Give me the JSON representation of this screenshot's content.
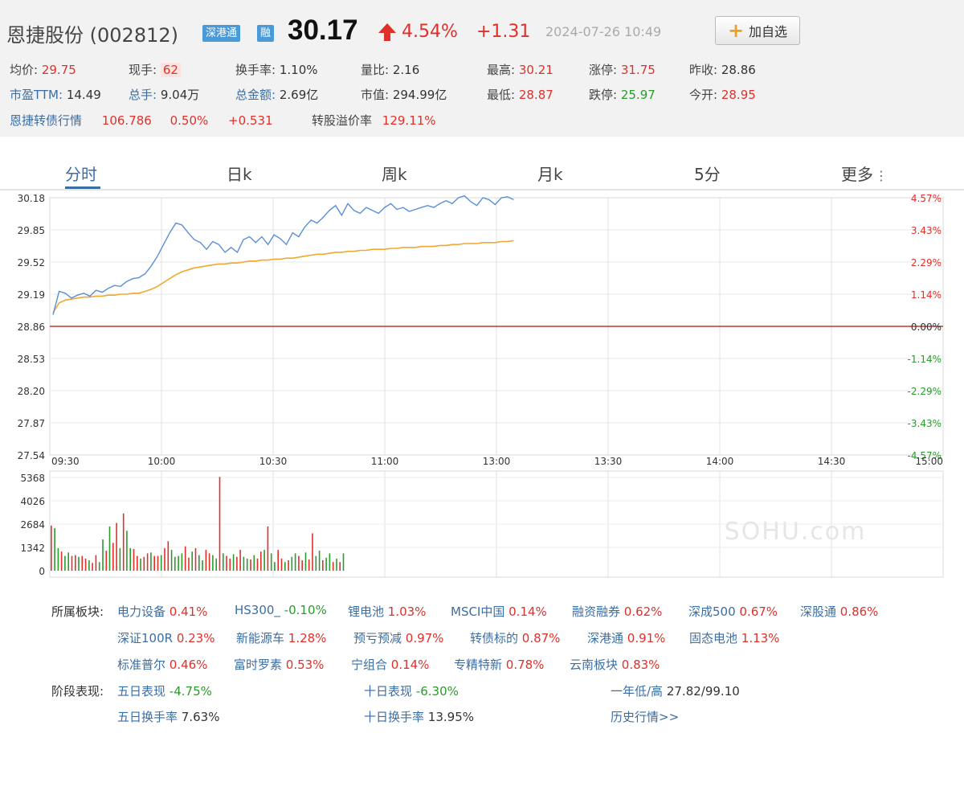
{
  "header": {
    "stock_name": "恩捷股份",
    "stock_code": "(002812)",
    "badges": [
      "深港通",
      "融"
    ],
    "price": "30.17",
    "change_pct": "4.54%",
    "change_amt": "+1.31",
    "datetime": "2024-07-26 10:49",
    "add_button": "加自选",
    "colors": {
      "up": "#e0302a",
      "down": "#2c9a2c",
      "link": "#3a6ea5",
      "badge": "#4b9ad8"
    }
  },
  "quote": {
    "avg_label": "均价:",
    "avg": "29.75",
    "now_vol_label": "现手:",
    "now_vol": "62",
    "turnover_label": "换手率:",
    "turnover": "1.10%",
    "vol_ratio_label": "量比:",
    "vol_ratio": "2.16",
    "high_label": "最高:",
    "high": "30.21",
    "limit_up_label": "涨停:",
    "limit_up": "31.75",
    "prev_close_label": "昨收:",
    "prev_close": "28.86",
    "pe_label": "市盈TTM:",
    "pe": "14.49",
    "total_vol_label": "总手:",
    "total_vol": "9.04万",
    "amount_label": "总金额:",
    "amount": "2.69亿",
    "mktcap_label": "市值:",
    "mktcap": "294.99亿",
    "low_label": "最低:",
    "low": "28.87",
    "limit_down_label": "跌停:",
    "limit_down": "25.97",
    "open_label": "今开:",
    "open": "28.95",
    "bond_label": "恩捷转债行情",
    "bond_price": "106.786",
    "bond_pct": "0.50%",
    "bond_chg": "+0.531",
    "premium_label": "转股溢价率",
    "premium": "129.11%"
  },
  "tabs": [
    "分时",
    "日k",
    "周k",
    "月k",
    "5分",
    "更多"
  ],
  "chart_data": {
    "type": "line",
    "prev_close": 28.86,
    "y_ticks": [
      "30.18",
      "29.85",
      "29.52",
      "29.19",
      "28.86",
      "28.53",
      "28.20",
      "27.87",
      "27.54"
    ],
    "pct_ticks": [
      "4.57%",
      "3.43%",
      "2.29%",
      "1.14%",
      "0.00%",
      "-1.14%",
      "-2.29%",
      "-3.43%",
      "-4.57%"
    ],
    "x_ticks": [
      "09:30",
      "10:00",
      "10:30",
      "11:00",
      "13:00",
      "13:30",
      "14:00",
      "14:30",
      "15:00"
    ],
    "ylim": [
      27.54,
      30.18
    ],
    "price_series": [
      28.98,
      29.22,
      29.2,
      29.15,
      29.18,
      29.2,
      29.17,
      29.23,
      29.21,
      29.25,
      29.28,
      29.27,
      29.32,
      29.35,
      29.36,
      29.4,
      29.48,
      29.58,
      29.7,
      29.82,
      29.92,
      29.9,
      29.82,
      29.75,
      29.72,
      29.65,
      29.73,
      29.7,
      29.62,
      29.67,
      29.62,
      29.75,
      29.78,
      29.72,
      29.78,
      29.7,
      29.8,
      29.76,
      29.7,
      29.82,
      29.78,
      29.88,
      29.95,
      29.92,
      29.98,
      30.05,
      30.1,
      30.0,
      30.12,
      30.05,
      30.02,
      30.08,
      30.05,
      30.02,
      30.08,
      30.12,
      30.06,
      30.08,
      30.04,
      30.06,
      30.08,
      30.1,
      30.08,
      30.12,
      30.15,
      30.12,
      30.18,
      30.2,
      30.14,
      30.1,
      30.18,
      30.16,
      30.11,
      30.18,
      30.19,
      30.16
    ],
    "avg_series": [
      29.0,
      29.1,
      29.13,
      29.14,
      29.15,
      29.16,
      29.16,
      29.17,
      29.17,
      29.18,
      29.18,
      29.19,
      29.19,
      29.2,
      29.2,
      29.22,
      29.24,
      29.27,
      29.31,
      29.35,
      29.39,
      29.42,
      29.44,
      29.46,
      29.47,
      29.48,
      29.49,
      29.5,
      29.5,
      29.51,
      29.51,
      29.52,
      29.53,
      29.53,
      29.54,
      29.54,
      29.55,
      29.55,
      29.56,
      29.56,
      29.57,
      29.58,
      29.59,
      29.6,
      29.6,
      29.61,
      29.62,
      29.62,
      29.63,
      29.63,
      29.64,
      29.64,
      29.65,
      29.65,
      29.65,
      29.66,
      29.66,
      29.67,
      29.67,
      29.67,
      29.68,
      29.68,
      29.68,
      29.69,
      29.69,
      29.7,
      29.7,
      29.71,
      29.71,
      29.71,
      29.72,
      29.72,
      29.72,
      29.73,
      29.73,
      29.74
    ],
    "volume_ticks": [
      "5368",
      "4026",
      "2684",
      "1342",
      "0"
    ],
    "volume_max": 5368,
    "volumes": [
      2600,
      2450,
      1300,
      1100,
      850,
      1050,
      850,
      900,
      800,
      850,
      700,
      600,
      450,
      900,
      500,
      1800,
      1150,
      2550,
      1600,
      2750,
      1300,
      3300,
      2300,
      1300,
      1250,
      850,
      700,
      800,
      1000,
      1050,
      850,
      850,
      900,
      1300,
      1700,
      1200,
      800,
      850,
      1000,
      1400,
      750,
      1100,
      1300,
      900,
      600,
      1200,
      1000,
      900,
      700,
      5400,
      1000,
      850,
      700,
      950,
      800,
      1200,
      800,
      700,
      650,
      900,
      700,
      1100,
      1200,
      2550,
      1000,
      500,
      1200,
      700,
      500,
      600,
      800,
      1000,
      850,
      600,
      1050,
      650,
      2150,
      850,
      1150,
      600,
      750,
      1000,
      500,
      700,
      500,
      1000
    ]
  },
  "watermark": "SOHU.com",
  "boards": {
    "label": "所属板块:",
    "rows": [
      [
        {
          "name": "电力设备",
          "value": "0.41%"
        },
        {
          "name": "HS300_",
          "value": "-0.10%"
        },
        {
          "name": "锂电池",
          "value": "1.03%"
        },
        {
          "name": "MSCI中国",
          "value": "0.14%"
        },
        {
          "name": "融资融券",
          "value": "0.62%"
        },
        {
          "name": "深成500",
          "value": "0.67%"
        },
        {
          "name": "深股通",
          "value": "0.86%"
        }
      ],
      [
        {
          "name": "深证100R",
          "value": "0.23%"
        },
        {
          "name": "新能源车",
          "value": "1.28%"
        },
        {
          "name": "预亏预减",
          "value": "0.97%"
        },
        {
          "name": "转债标的",
          "value": "0.87%"
        },
        {
          "name": "深港通",
          "value": "0.91%"
        },
        {
          "name": "固态电池",
          "value": "1.13%"
        }
      ],
      [
        {
          "name": "标准普尔",
          "value": "0.46%"
        },
        {
          "name": "富时罗素",
          "value": "0.53%"
        },
        {
          "name": "宁组合",
          "value": "0.14%"
        },
        {
          "name": "专精特新",
          "value": "0.78%"
        },
        {
          "name": "云南板块",
          "value": "0.83%"
        }
      ]
    ]
  },
  "stage": {
    "label": "阶段表现:",
    "five_day_label": "五日表现",
    "five_day": "-4.75%",
    "ten_day_label": "十日表现",
    "ten_day": "-6.30%",
    "year_label": "一年低/高",
    "year": "27.82/99.10",
    "five_turn_label": "五日换手率",
    "five_turn": "7.63%",
    "ten_turn_label": "十日换手率",
    "ten_turn": "13.95%",
    "history_link": "历史行情>>"
  }
}
